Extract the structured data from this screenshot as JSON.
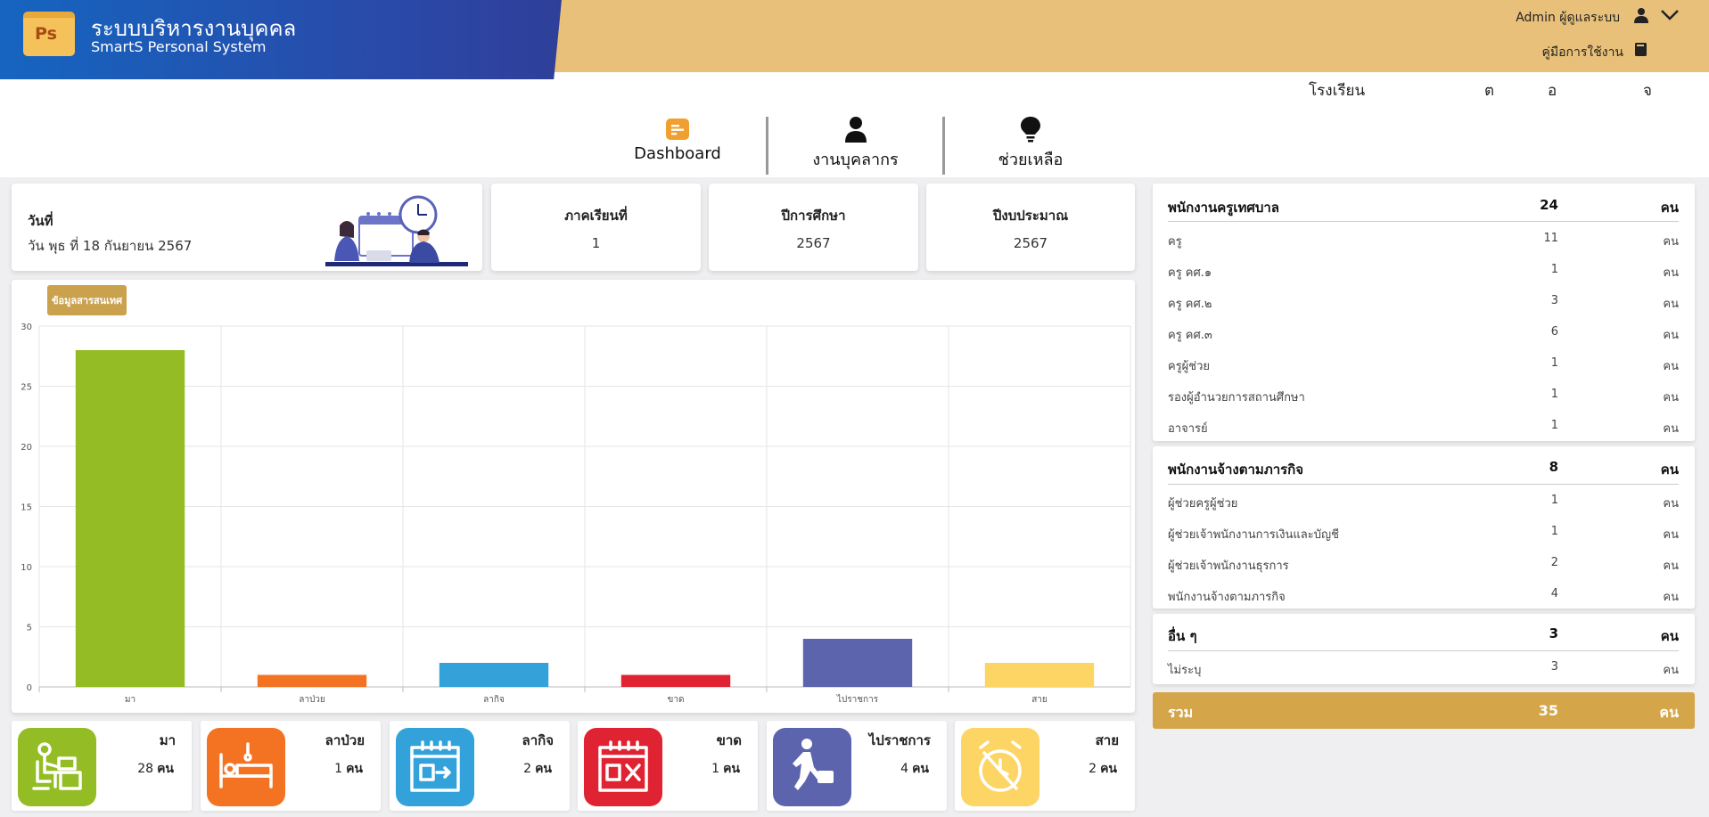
{
  "header": {
    "app_title": "ระบบบริหารงานบุคคล",
    "app_subtitle": "SmartS Personal System",
    "logo_text": "Ps",
    "admin_label": "Admin ผู้ดูแลระบบ",
    "manual_label": "คู่มือการใช้งาน"
  },
  "school_row": [
    "โรงเรียน",
    "ต",
    "อ",
    "จ"
  ],
  "nav": [
    {
      "label": "Dashboard",
      "icon": "dashboard-icon"
    },
    {
      "label": "งานบุคลากร",
      "icon": "person-icon"
    },
    {
      "label": "ช่วยเหลือ",
      "icon": "lightbulb-icon"
    }
  ],
  "date_card": {
    "label": "วันที่",
    "value": "วัน พุธ ที่ 18 กันยายน 2567"
  },
  "info_cards": [
    {
      "title": "ภาคเรียนที่",
      "value": "1"
    },
    {
      "title": "ปีการศึกษา",
      "value": "2567"
    },
    {
      "title": "ปีงบประมาณ",
      "value": "2567"
    }
  ],
  "chart_tag": "ข้อมูลสารสนเทศ",
  "chart_data": {
    "type": "bar",
    "categories": [
      "มา",
      "ลาป่วย",
      "ลากิจ",
      "ขาด",
      "ไปราชการ",
      "สาย"
    ],
    "values": [
      28,
      1,
      2,
      1,
      4,
      2
    ],
    "colors": [
      "#93bc25",
      "#f47323",
      "#33a2da",
      "#e02332",
      "#5c64ad",
      "#fdd565"
    ],
    "ylim": [
      0,
      30
    ],
    "yticks": [
      0,
      5,
      10,
      15,
      20,
      25,
      30
    ],
    "grid": true
  },
  "staff_groups": [
    {
      "title": "พนักงานครูเทศบาล",
      "count": "24",
      "unit": "คน",
      "rows": [
        {
          "name": "ครู",
          "count": "11",
          "unit": "คน"
        },
        {
          "name": "ครู คศ.๑",
          "count": "1",
          "unit": "คน"
        },
        {
          "name": "ครู คศ.๒",
          "count": "3",
          "unit": "คน"
        },
        {
          "name": "ครู คศ.๓",
          "count": "6",
          "unit": "คน"
        },
        {
          "name": "ครูผู้ช่วย",
          "count": "1",
          "unit": "คน"
        },
        {
          "name": "รองผู้อำนวยการสถานศึกษา",
          "count": "1",
          "unit": "คน"
        },
        {
          "name": "อาจารย์",
          "count": "1",
          "unit": "คน"
        }
      ]
    },
    {
      "title": "พนักงานจ้างตามภารกิจ",
      "count": "8",
      "unit": "คน",
      "rows": [
        {
          "name": "ผู้ช่วยครูผู้ช่วย",
          "count": "1",
          "unit": "คน"
        },
        {
          "name": "ผู้ช่วยเจ้าพนักงานการเงินและบัญชี",
          "count": "1",
          "unit": "คน"
        },
        {
          "name": "ผู้ช่วยเจ้าพนักงานธุรการ",
          "count": "2",
          "unit": "คน"
        },
        {
          "name": "พนักงานจ้างตามภารกิจ",
          "count": "4",
          "unit": "คน"
        }
      ]
    },
    {
      "title": "อื่น ๆ",
      "count": "3",
      "unit": "คน",
      "rows": [
        {
          "name": "ไม่ระบุ",
          "count": "3",
          "unit": "คน"
        }
      ]
    }
  ],
  "total": {
    "label": "รวม",
    "count": "35",
    "unit": "คน"
  },
  "status_cards": [
    {
      "label": "มา",
      "count": "28",
      "unit": "คน",
      "color": "#93bc25",
      "icon": "desk-worker-icon"
    },
    {
      "label": "ลาป่วย",
      "count": "1",
      "unit": "คน",
      "color": "#f47323",
      "icon": "sick-bed-icon"
    },
    {
      "label": "ลากิจ",
      "count": "2",
      "unit": "คน",
      "color": "#33a2da",
      "icon": "calendar-leave-icon"
    },
    {
      "label": "ขาด",
      "count": "1",
      "unit": "คน",
      "color": "#e02332",
      "icon": "calendar-absent-icon"
    },
    {
      "label": "ไปราชการ",
      "count": "4",
      "unit": "คน",
      "color": "#5c64ad",
      "icon": "business-travel-icon"
    },
    {
      "label": "สาย",
      "count": "2",
      "unit": "คน",
      "color": "#fdd565",
      "icon": "late-alarm-icon"
    }
  ]
}
